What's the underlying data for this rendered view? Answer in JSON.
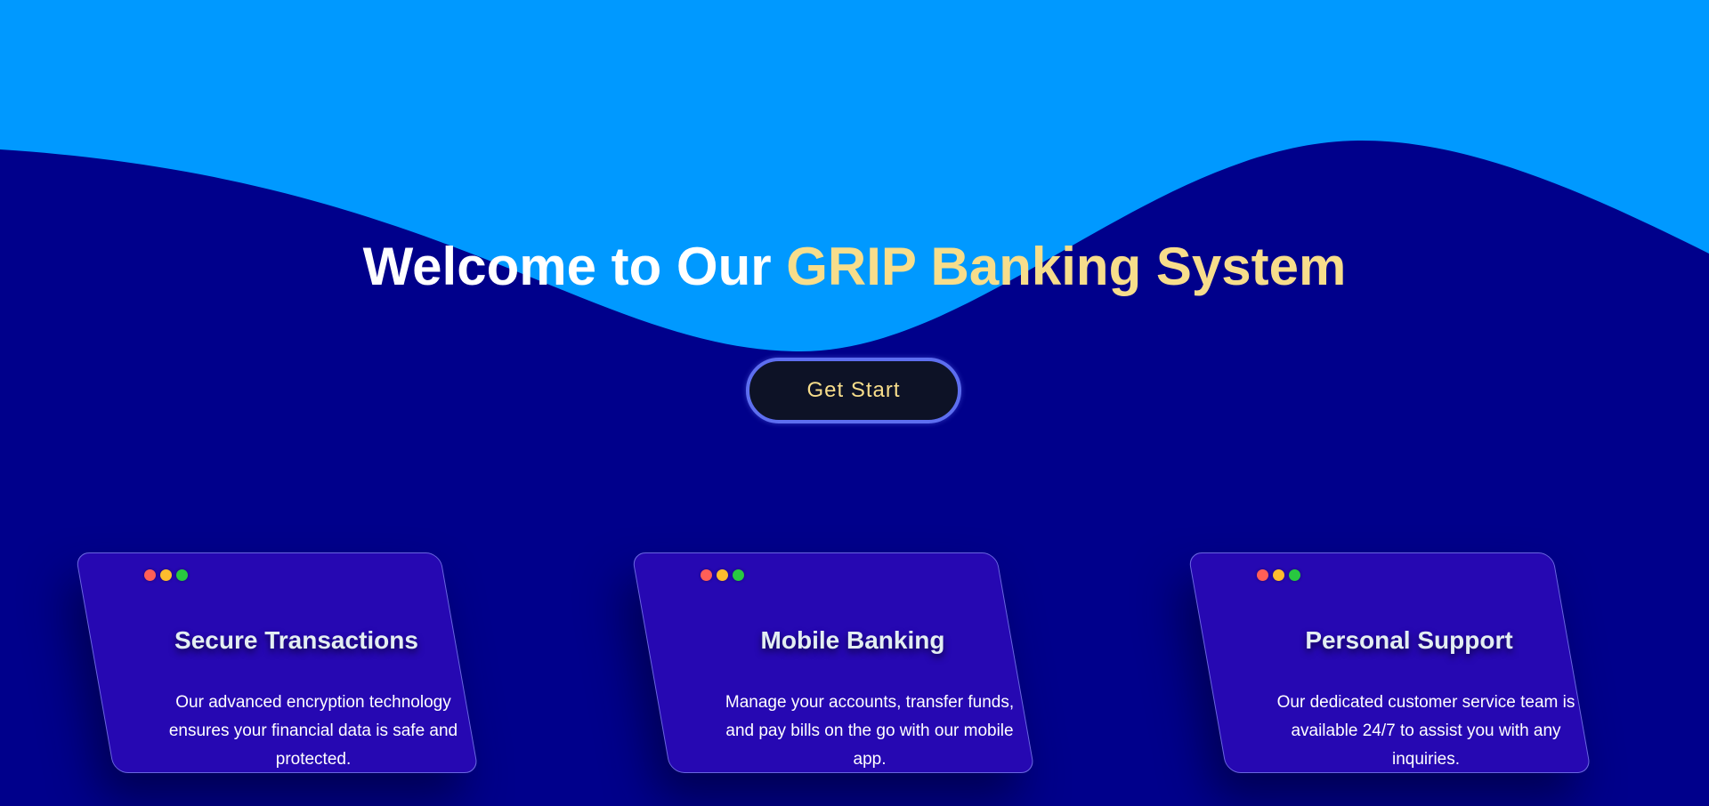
{
  "colors": {
    "background": "#00008b",
    "wave": "#0099ff",
    "accent": "#f7dd8b",
    "card": "#2608b2",
    "button_border": "#5d6ef0",
    "button_bg": "#0d1226"
  },
  "hero": {
    "title_prefix": "Welcome to Our ",
    "title_accent": "GRIP Banking System"
  },
  "cta": {
    "label": "Get Start"
  },
  "features": [
    {
      "title": "Secure Transactions",
      "description": "Our advanced encryption technology ensures your financial data is safe and protected."
    },
    {
      "title": "Mobile Banking",
      "description": "Manage your accounts, transfer funds, and pay bills on the go with our mobile app."
    },
    {
      "title": "Personal Support",
      "description": "Our dedicated customer service team is available 24/7 to assist you with any inquiries."
    }
  ]
}
